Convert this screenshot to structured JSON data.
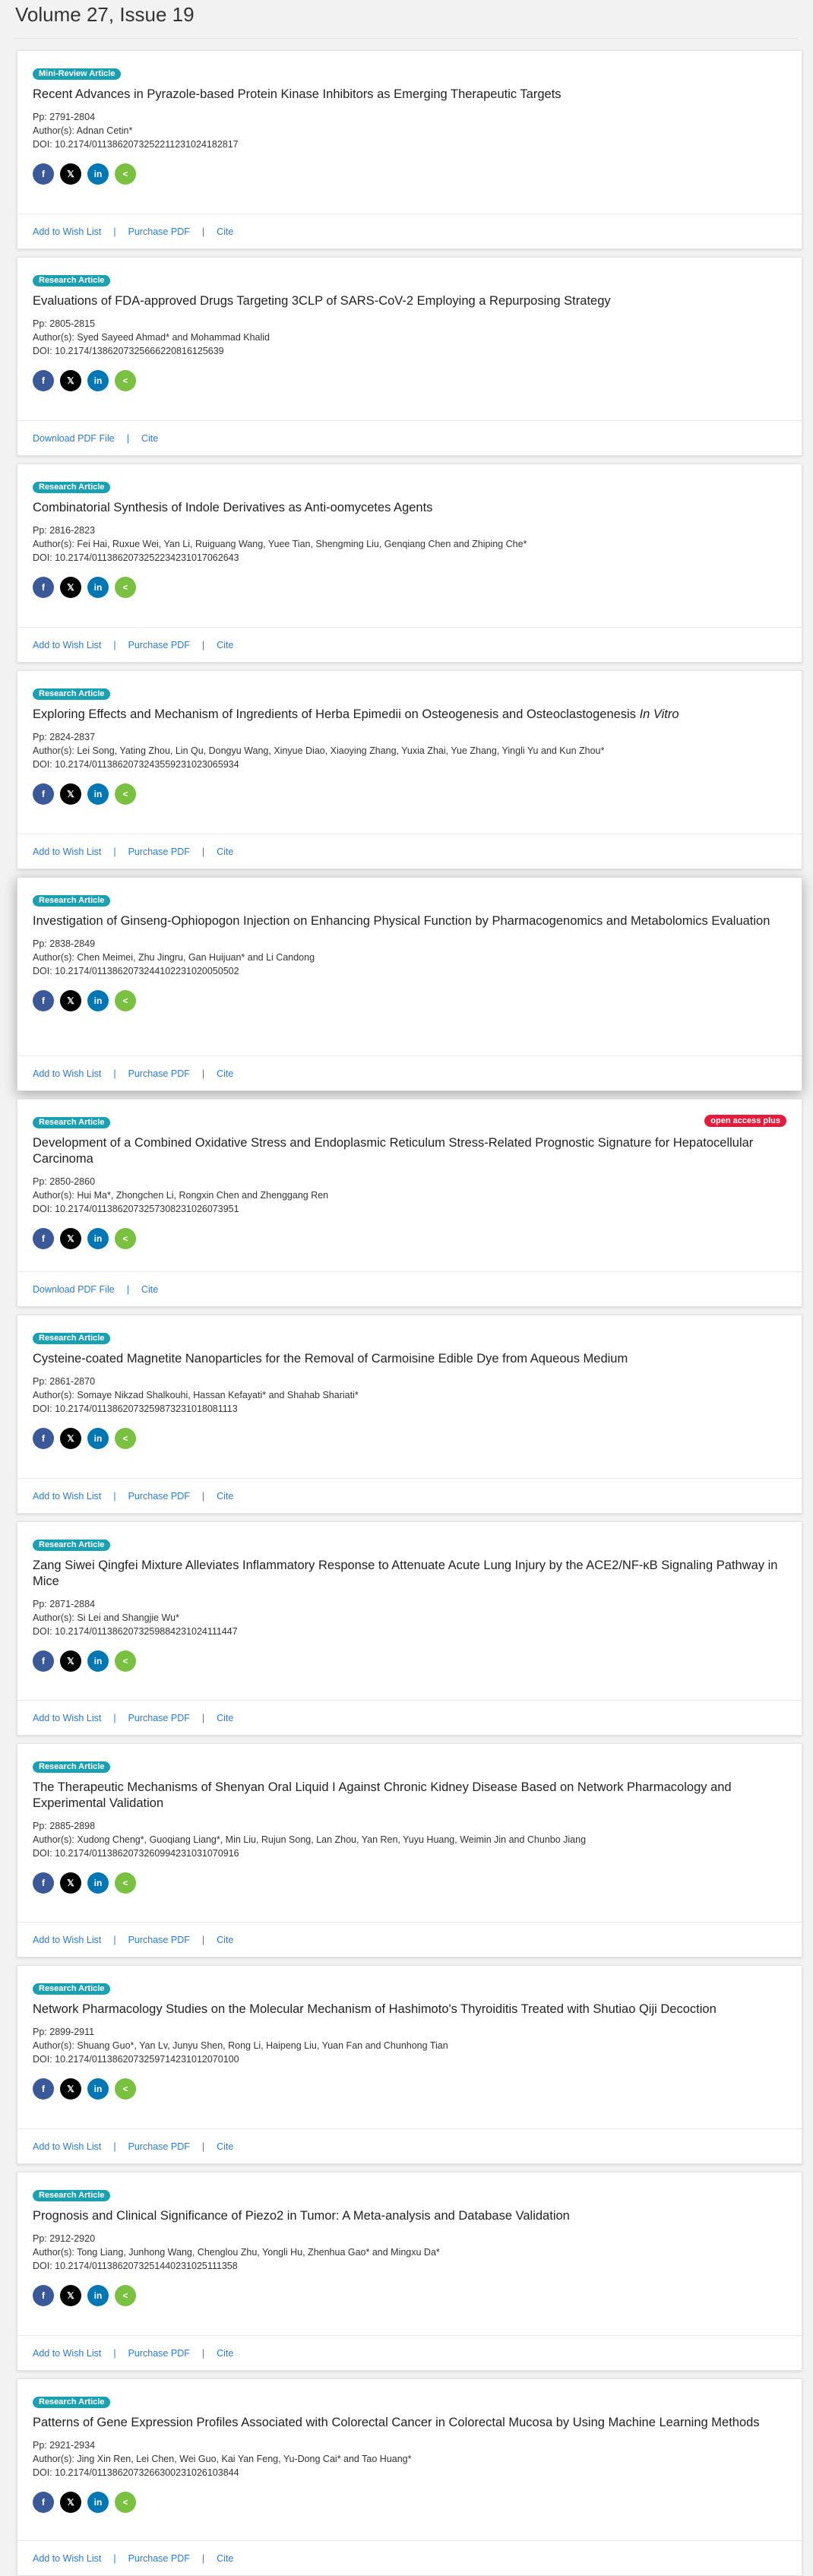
{
  "volume_title": "Volume 27, Issue 19",
  "labels": {
    "pp_prefix": "Pp: ",
    "authors_prefix": "Author(s): ",
    "doi_prefix": "DOI: ",
    "add_to_wish_list": "Add to Wish List",
    "purchase_pdf": "Purchase PDF",
    "download_pdf": "Download PDF File",
    "cite": "Cite",
    "separator": "|",
    "open_access": "open access plus"
  },
  "social_icons": {
    "facebook": "f",
    "twitter": "𝕏",
    "linkedin": "in",
    "share": "<"
  },
  "colors": {
    "badge": "#1aa1b1",
    "open_access": "#e31b3c",
    "link": "#2a7bd6",
    "facebook": "#3b5998",
    "twitter": "#000000",
    "linkedin": "#0077b5",
    "share": "#7ac142"
  },
  "articles": [
    {
      "type": "Mini-Review Article",
      "title": "Recent Advances in Pyrazole-based Protein Kinase Inhibitors as Emerging Therapeutic Targets",
      "pages": "2791-2804",
      "authors": "Adnan Cetin*",
      "doi": "10.2174/0113862073252211231024182817",
      "footer": "wishlist"
    },
    {
      "type": "Research Article",
      "title": "Evaluations of FDA-approved Drugs Targeting 3CLP of SARS-CoV-2 Employing a Repurposing Strategy",
      "pages": "2805-2815",
      "authors": "Syed Sayeed Ahmad* and Mohammad Khalid",
      "doi": "10.2174/1386207325666220816125639",
      "footer": "download"
    },
    {
      "type": "Research Article",
      "title": "Combinatorial Synthesis of Indole Derivatives as Anti-oomycetes Agents",
      "pages": "2816-2823",
      "authors": "Fei Hai, Ruxue Wei, Yan Li, Ruiguang Wang, Yuee Tian, Shengming Liu, Genqiang Chen and Zhiping Che*",
      "doi": "10.2174/0113862073252234231017062643",
      "footer": "wishlist"
    },
    {
      "type": "Research Article",
      "title": "Exploring Effects and Mechanism of Ingredients of Herba Epimedii on Osteogenesis and Osteoclastogenesis",
      "title_italic": "In Vitro",
      "pages": "2824-2837",
      "authors": "Lei Song, Yating Zhou, Lin Qu, Dongyu Wang, Xinyue Diao, Xiaoying Zhang, Yuxia Zhai, Yue Zhang, Yingli Yu and Kun Zhou*",
      "doi": "10.2174/0113862073243559231023065934",
      "footer": "wishlist"
    },
    {
      "type": "Research Article",
      "title": "Investigation of Ginseng-Ophiopogon Injection on Enhancing Physical Function by Pharmacogenomics and Metabolomics Evaluation",
      "pages": "2838-2849",
      "authors": "Chen Meimei, Zhu Jingru, Gan Huijuan* and Li Candong",
      "doi": "10.2174/0113862073244102231020050502",
      "footer": "wishlist"
    },
    {
      "type": "Research Article",
      "title": "Development of a Combined Oxidative Stress and Endoplasmic Reticulum Stress-Related Prognostic Signature for Hepatocellular Carcinoma",
      "pages": "2850-2860",
      "authors": "Hui Ma*, Zhongchen Li, Rongxin Chen and Zhenggang Ren",
      "doi": "10.2174/0113862073257308231026073951",
      "footer": "download",
      "open_access": true
    },
    {
      "type": "Research Article",
      "title": "Cysteine-coated Magnetite Nanoparticles for the Removal of Carmoisine Edible Dye from Aqueous Medium",
      "pages": "2861-2870",
      "authors": "Somaye Nikzad Shalkouhi, Hassan Kefayati* and Shahab Shariati*",
      "doi": "10.2174/0113862073259873231018081113",
      "footer": "wishlist"
    },
    {
      "type": "Research Article",
      "title": "Zang Siwei Qingfei Mixture Alleviates Inflammatory Response to Attenuate Acute Lung Injury by the ACE2/NF-κB Signaling Pathway in Mice",
      "pages": "2871-2884",
      "authors": "Si Lei and Shangjie Wu*",
      "doi": "10.2174/0113862073259884231024111447",
      "footer": "wishlist"
    },
    {
      "type": "Research Article",
      "title": "The Therapeutic Mechanisms of Shenyan Oral Liquid I Against Chronic Kidney Disease Based on Network Pharmacology and Experimental Validation",
      "pages": "2885-2898",
      "authors": "Xudong Cheng*, Guoqiang Liang*, Min Liu, Rujun Song, Lan Zhou, Yan Ren, Yuyu Huang, Weimin Jin and Chunbo Jiang",
      "doi": "10.2174/0113862073260994231031070916",
      "footer": "wishlist"
    },
    {
      "type": "Research Article",
      "title": "Network Pharmacology Studies on the Molecular Mechanism of Hashimoto's Thyroiditis Treated with Shutiao Qiji Decoction",
      "pages": "2899-2911",
      "authors": "Shuang Guo*, Yan Lv, Junyu Shen, Rong Li, Haipeng Liu, Yuan Fan and Chunhong Tian",
      "doi": "10.2174/0113862073259714231012070100",
      "footer": "wishlist"
    },
    {
      "type": "Research Article",
      "title": "Prognosis and Clinical Significance of Piezo2 in Tumor: A Meta-analysis and Database Validation",
      "pages": "2912-2920",
      "authors": "Tong Liang, Junhong Wang, Chenglou Zhu, Yongli Hu, Zhenhua Gao* and Mingxu Da*",
      "doi": "10.2174/0113862073251440231025111358",
      "footer": "wishlist"
    },
    {
      "type": "Research Article",
      "title": "Patterns of Gene Expression Profiles Associated with Colorectal Cancer in Colorectal Mucosa by Using Machine Learning Methods",
      "pages": "2921-2934",
      "authors": "Jing Xin Ren, Lei Chen, Wei Guo, Kai Yan Feng, Yu-Dong Cai* and Tao Huang*",
      "doi": "10.2174/0113862073266300231026103844",
      "footer": "wishlist"
    }
  ]
}
